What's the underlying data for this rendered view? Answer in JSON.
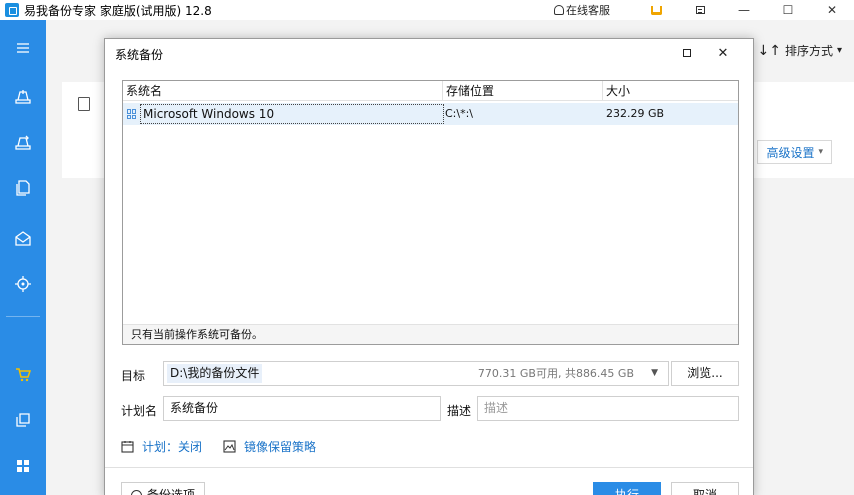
{
  "app": {
    "title": "易我备份专家 家庭版(试用版) 12.8",
    "online_service": "在线客服",
    "minimize": "—",
    "maximize": "☐",
    "close": "✕"
  },
  "main": {
    "sort_label": "排序方式",
    "sort_arrows": "↓↑",
    "sort_caret": "▾",
    "advanced_label": "高级设置",
    "advanced_caret": "▾"
  },
  "dialog": {
    "title": "系统备份",
    "close": "✕",
    "columns": [
      "系统名",
      "存储位置",
      "大小"
    ],
    "rows": [
      {
        "name": "Microsoft Windows 10",
        "location": "C:\\*:\\",
        "size": "232.29 GB"
      }
    ],
    "note": "只有当前操作系统可备份。",
    "target_label": "目标",
    "target_path": "D:\\我的备份文件",
    "target_free": "770.31 GB可用, 共886.45 GB",
    "target_arrow": "▼",
    "browse_label": "浏览...",
    "plan_label": "计划名",
    "plan_value": "系统备份",
    "desc_label": "描述",
    "desc_placeholder": "描述",
    "schedule_link": "计划：关闭",
    "retention_link": "镜像保留策略",
    "options_button": "备份选项",
    "exec_button": "执行",
    "cancel_button": "取消"
  },
  "colors": {
    "accent": "#2a8ce6",
    "link": "#1a73c8",
    "selected_row": "#e6f1fb"
  }
}
